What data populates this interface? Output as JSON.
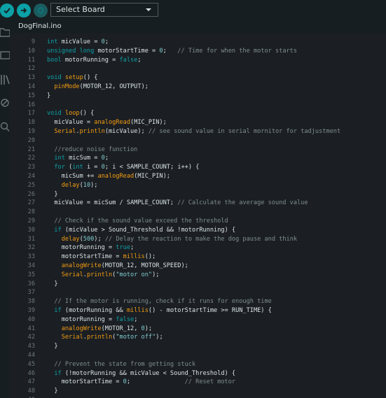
{
  "toolbar": {
    "verify_icon": "check-icon",
    "upload_icon": "arrow-right-icon",
    "debug_icon": "debug-icon",
    "board_select": "Select Board",
    "accent": "#0ca1a6"
  },
  "sidebar": {
    "icons": [
      "folder-icon",
      "board-manager-icon",
      "library-icon",
      "debug-icon",
      "search-icon"
    ]
  },
  "tab": {
    "filename": "DogFinal.ino"
  },
  "editor": {
    "lines": [
      {
        "n": "9",
        "tokens": [
          {
            "t": "int",
            "c": "kw"
          },
          {
            "t": " micValue = ",
            "c": "txt"
          },
          {
            "t": "0",
            "c": "num"
          },
          {
            "t": ";",
            "c": "txt"
          }
        ]
      },
      {
        "n": "10",
        "tokens": [
          {
            "t": "unsigned long",
            "c": "kw"
          },
          {
            "t": " motorStartTime = ",
            "c": "txt"
          },
          {
            "t": "0",
            "c": "num"
          },
          {
            "t": ";   ",
            "c": "txt"
          },
          {
            "t": "// Time for when the motor starts",
            "c": "cm"
          }
        ]
      },
      {
        "n": "11",
        "tokens": [
          {
            "t": "bool",
            "c": "kw"
          },
          {
            "t": " motorRunning = ",
            "c": "txt"
          },
          {
            "t": "false",
            "c": "kw"
          },
          {
            "t": ";",
            "c": "txt"
          }
        ]
      },
      {
        "n": "12",
        "tokens": []
      },
      {
        "n": "13",
        "tokens": [
          {
            "t": "void",
            "c": "kw"
          },
          {
            "t": " ",
            "c": "txt"
          },
          {
            "t": "setup",
            "c": "fn"
          },
          {
            "t": "() {",
            "c": "txt"
          }
        ]
      },
      {
        "n": "14",
        "tokens": [
          {
            "t": "  ",
            "c": "txt"
          },
          {
            "t": "pinMode",
            "c": "fn"
          },
          {
            "t": "(MOTOR_12, OUTPUT);",
            "c": "txt"
          }
        ]
      },
      {
        "n": "15",
        "tokens": [
          {
            "t": "}",
            "c": "txt"
          }
        ]
      },
      {
        "n": "16",
        "tokens": []
      },
      {
        "n": "17",
        "tokens": [
          {
            "t": "void",
            "c": "kw"
          },
          {
            "t": " ",
            "c": "txt"
          },
          {
            "t": "loop",
            "c": "fn"
          },
          {
            "t": "() {",
            "c": "txt"
          }
        ]
      },
      {
        "n": "18",
        "tokens": [
          {
            "t": "  micValue = ",
            "c": "txt"
          },
          {
            "t": "analogRead",
            "c": "fn"
          },
          {
            "t": "(MIC_PIN);",
            "c": "txt"
          }
        ]
      },
      {
        "n": "19",
        "tokens": [
          {
            "t": "  ",
            "c": "txt"
          },
          {
            "t": "Serial",
            "c": "fn"
          },
          {
            "t": ".",
            "c": "txt"
          },
          {
            "t": "println",
            "c": "fn"
          },
          {
            "t": "(micValue); ",
            "c": "txt"
          },
          {
            "t": "// see sound value in serial mornitor for tadjustment",
            "c": "cm"
          }
        ]
      },
      {
        "n": "20",
        "tokens": []
      },
      {
        "n": "21",
        "tokens": [
          {
            "t": "  ",
            "c": "txt"
          },
          {
            "t": "//reduce noise function",
            "c": "cm"
          }
        ]
      },
      {
        "n": "22",
        "tokens": [
          {
            "t": "  ",
            "c": "txt"
          },
          {
            "t": "int",
            "c": "kw"
          },
          {
            "t": " micSum = ",
            "c": "txt"
          },
          {
            "t": "0",
            "c": "num"
          },
          {
            "t": ";",
            "c": "txt"
          }
        ]
      },
      {
        "n": "23",
        "tokens": [
          {
            "t": "  ",
            "c": "txt"
          },
          {
            "t": "for",
            "c": "kw"
          },
          {
            "t": " (",
            "c": "txt"
          },
          {
            "t": "int",
            "c": "kw"
          },
          {
            "t": " i = ",
            "c": "txt"
          },
          {
            "t": "0",
            "c": "num"
          },
          {
            "t": "; i < SAMPLE_COUNT; i++) {",
            "c": "txt"
          }
        ]
      },
      {
        "n": "24",
        "tokens": [
          {
            "t": "    micSum += ",
            "c": "txt"
          },
          {
            "t": "analogRead",
            "c": "fn"
          },
          {
            "t": "(MIC_PIN);",
            "c": "txt"
          }
        ]
      },
      {
        "n": "25",
        "tokens": [
          {
            "t": "    ",
            "c": "txt"
          },
          {
            "t": "delay",
            "c": "fn"
          },
          {
            "t": "(",
            "c": "txt"
          },
          {
            "t": "10",
            "c": "num"
          },
          {
            "t": ");",
            "c": "txt"
          }
        ]
      },
      {
        "n": "26",
        "tokens": [
          {
            "t": "  }",
            "c": "txt"
          }
        ]
      },
      {
        "n": "27",
        "tokens": [
          {
            "t": "  micValue = micSum / SAMPLE_COUNT; ",
            "c": "txt"
          },
          {
            "t": "// Calculate the average sound value",
            "c": "cm"
          }
        ]
      },
      {
        "n": "28",
        "tokens": []
      },
      {
        "n": "29",
        "tokens": [
          {
            "t": "  ",
            "c": "txt"
          },
          {
            "t": "// Check if the sound value exceed the threshold",
            "c": "cm"
          }
        ]
      },
      {
        "n": "30",
        "tokens": [
          {
            "t": "  ",
            "c": "txt"
          },
          {
            "t": "if",
            "c": "kw"
          },
          {
            "t": " (micValue > Sound_Threshold && !motorRunning) {",
            "c": "txt"
          }
        ]
      },
      {
        "n": "31",
        "tokens": [
          {
            "t": "    ",
            "c": "txt"
          },
          {
            "t": "delay",
            "c": "fn"
          },
          {
            "t": "(",
            "c": "txt"
          },
          {
            "t": "500",
            "c": "num"
          },
          {
            "t": "); ",
            "c": "txt"
          },
          {
            "t": "// Delay the reaction to make the dog pause and think",
            "c": "cm"
          }
        ]
      },
      {
        "n": "32",
        "tokens": [
          {
            "t": "    motorRunning = ",
            "c": "txt"
          },
          {
            "t": "true",
            "c": "kw"
          },
          {
            "t": ";",
            "c": "txt"
          }
        ]
      },
      {
        "n": "33",
        "tokens": [
          {
            "t": "    motorStartTime = ",
            "c": "txt"
          },
          {
            "t": "millis",
            "c": "fn"
          },
          {
            "t": "();",
            "c": "txt"
          }
        ]
      },
      {
        "n": "34",
        "tokens": [
          {
            "t": "    ",
            "c": "txt"
          },
          {
            "t": "analogWrite",
            "c": "fn"
          },
          {
            "t": "(MOTOR_12, MOTOR_SPEED);",
            "c": "txt"
          }
        ]
      },
      {
        "n": "35",
        "tokens": [
          {
            "t": "    ",
            "c": "txt"
          },
          {
            "t": "Serial",
            "c": "fn"
          },
          {
            "t": ".",
            "c": "txt"
          },
          {
            "t": "println",
            "c": "fn"
          },
          {
            "t": "(",
            "c": "txt"
          },
          {
            "t": "\"motor on\"",
            "c": "str"
          },
          {
            "t": ");",
            "c": "txt"
          }
        ]
      },
      {
        "n": "36",
        "tokens": [
          {
            "t": "  }",
            "c": "txt"
          }
        ]
      },
      {
        "n": "37",
        "tokens": []
      },
      {
        "n": "38",
        "tokens": [
          {
            "t": "  ",
            "c": "txt"
          },
          {
            "t": "// If the motor is running, check if it runs for enough time",
            "c": "cm"
          }
        ]
      },
      {
        "n": "39",
        "tokens": [
          {
            "t": "  ",
            "c": "txt"
          },
          {
            "t": "if",
            "c": "kw"
          },
          {
            "t": " (motorRunning && ",
            "c": "txt"
          },
          {
            "t": "millis",
            "c": "fn"
          },
          {
            "t": "() - motorStartTime >= RUN_TIME) {",
            "c": "txt"
          }
        ]
      },
      {
        "n": "40",
        "tokens": [
          {
            "t": "    motorRunning = ",
            "c": "txt"
          },
          {
            "t": "false",
            "c": "kw"
          },
          {
            "t": ";",
            "c": "txt"
          }
        ]
      },
      {
        "n": "41",
        "tokens": [
          {
            "t": "    ",
            "c": "txt"
          },
          {
            "t": "analogWrite",
            "c": "fn"
          },
          {
            "t": "(MOTOR_12, ",
            "c": "txt"
          },
          {
            "t": "0",
            "c": "num"
          },
          {
            "t": ");",
            "c": "txt"
          }
        ]
      },
      {
        "n": "42",
        "tokens": [
          {
            "t": "    ",
            "c": "txt"
          },
          {
            "t": "Serial",
            "c": "fn"
          },
          {
            "t": ".",
            "c": "txt"
          },
          {
            "t": "println",
            "c": "fn"
          },
          {
            "t": "(",
            "c": "txt"
          },
          {
            "t": "\"motor off\"",
            "c": "str"
          },
          {
            "t": ");",
            "c": "txt"
          }
        ]
      },
      {
        "n": "43",
        "tokens": [
          {
            "t": "  }",
            "c": "txt"
          }
        ]
      },
      {
        "n": "44",
        "tokens": []
      },
      {
        "n": "45",
        "tokens": [
          {
            "t": "  ",
            "c": "txt"
          },
          {
            "t": "// Prevent the state from getting stuck",
            "c": "cm"
          }
        ]
      },
      {
        "n": "46",
        "tokens": [
          {
            "t": "  ",
            "c": "txt"
          },
          {
            "t": "if",
            "c": "kw"
          },
          {
            "t": " (!motorRunning && micValue < Sound_Threshold) {",
            "c": "txt"
          }
        ]
      },
      {
        "n": "47",
        "tokens": [
          {
            "t": "    motorStartTime = ",
            "c": "txt"
          },
          {
            "t": "0",
            "c": "num"
          },
          {
            "t": ";               ",
            "c": "txt"
          },
          {
            "t": "// Reset motor",
            "c": "cm"
          }
        ]
      },
      {
        "n": "48",
        "tokens": [
          {
            "t": "  }",
            "c": "txt"
          }
        ]
      },
      {
        "n": "49",
        "tokens": []
      }
    ]
  }
}
